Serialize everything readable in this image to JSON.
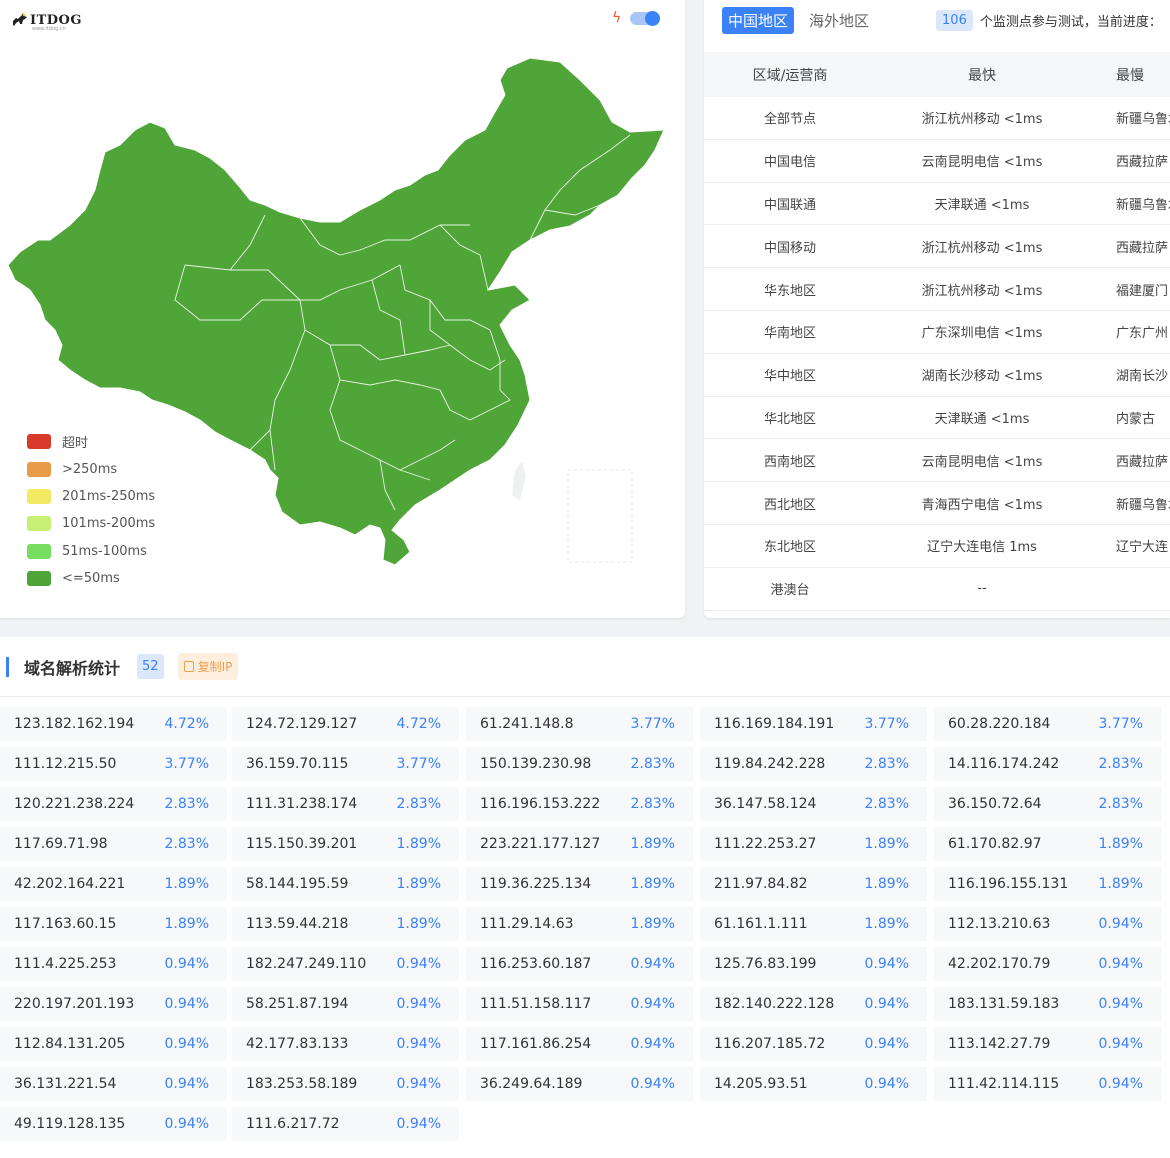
{
  "logo": {
    "text": "ITDOG",
    "sub": "www.itdog.cn"
  },
  "legend": [
    {
      "label": "超时",
      "color": "#d93a2b"
    },
    {
      "label": ">250ms",
      "color": "#e89c4a"
    },
    {
      "label": "201ms-250ms",
      "color": "#f2ea63"
    },
    {
      "label": "101ms-200ms",
      "color": "#c8ef76"
    },
    {
      "label": "51ms-100ms",
      "color": "#77dd5e"
    },
    {
      "label": "<=50ms",
      "color": "#4fa538"
    }
  ],
  "colors": {
    "map_fill": "#4fa538",
    "accent": "#3b82f6"
  },
  "region_panel": {
    "tab_active": "中国地区",
    "tab_other": "海外地区",
    "count": "106",
    "progress_text": "个监测点参与测试，当前进度：",
    "headers": [
      "区域/运营商",
      "最快",
      "最慢"
    ],
    "rows": [
      [
        "全部节点",
        "浙江杭州移动 <1ms",
        "新疆乌鲁木齐"
      ],
      [
        "中国电信",
        "云南昆明电信 <1ms",
        "西藏拉萨"
      ],
      [
        "中国联通",
        "天津联通 <1ms",
        "新疆乌鲁木齐"
      ],
      [
        "中国移动",
        "浙江杭州移动 <1ms",
        "西藏拉萨"
      ],
      [
        "华东地区",
        "浙江杭州移动 <1ms",
        "福建厦门"
      ],
      [
        "华南地区",
        "广东深圳电信 <1ms",
        "广东广州"
      ],
      [
        "华中地区",
        "湖南长沙移动 <1ms",
        "湖南长沙"
      ],
      [
        "华北地区",
        "天津联通 <1ms",
        "内蒙古"
      ],
      [
        "西南地区",
        "云南昆明电信 <1ms",
        "西藏拉萨"
      ],
      [
        "西北地区",
        "青海西宁电信 <1ms",
        "新疆乌鲁木齐"
      ],
      [
        "东北地区",
        "辽宁大连电信 1ms",
        "辽宁大连"
      ],
      [
        "港澳台",
        "--",
        ""
      ]
    ]
  },
  "dns": {
    "title": "域名解析统计",
    "count": "52",
    "copy_label": "复制IP",
    "items": [
      [
        "123.182.162.194",
        "4.72%"
      ],
      [
        "124.72.129.127",
        "4.72%"
      ],
      [
        "61.241.148.8",
        "3.77%"
      ],
      [
        "116.169.184.191",
        "3.77%"
      ],
      [
        "60.28.220.184",
        "3.77%"
      ],
      [
        "111.12.215.50",
        "3.77%"
      ],
      [
        "36.159.70.115",
        "3.77%"
      ],
      [
        "150.139.230.98",
        "2.83%"
      ],
      [
        "119.84.242.228",
        "2.83%"
      ],
      [
        "14.116.174.242",
        "2.83%"
      ],
      [
        "120.221.238.224",
        "2.83%"
      ],
      [
        "111.31.238.174",
        "2.83%"
      ],
      [
        "116.196.153.222",
        "2.83%"
      ],
      [
        "36.147.58.124",
        "2.83%"
      ],
      [
        "36.150.72.64",
        "2.83%"
      ],
      [
        "117.69.71.98",
        "2.83%"
      ],
      [
        "115.150.39.201",
        "1.89%"
      ],
      [
        "223.221.177.127",
        "1.89%"
      ],
      [
        "111.22.253.27",
        "1.89%"
      ],
      [
        "61.170.82.97",
        "1.89%"
      ],
      [
        "42.202.164.221",
        "1.89%"
      ],
      [
        "58.144.195.59",
        "1.89%"
      ],
      [
        "119.36.225.134",
        "1.89%"
      ],
      [
        "211.97.84.82",
        "1.89%"
      ],
      [
        "116.196.155.131",
        "1.89%"
      ],
      [
        "117.163.60.15",
        "1.89%"
      ],
      [
        "113.59.44.218",
        "1.89%"
      ],
      [
        "111.29.14.63",
        "1.89%"
      ],
      [
        "61.161.1.111",
        "1.89%"
      ],
      [
        "112.13.210.63",
        "0.94%"
      ],
      [
        "111.4.225.253",
        "0.94%"
      ],
      [
        "182.247.249.110",
        "0.94%"
      ],
      [
        "116.253.60.187",
        "0.94%"
      ],
      [
        "125.76.83.199",
        "0.94%"
      ],
      [
        "42.202.170.79",
        "0.94%"
      ],
      [
        "220.197.201.193",
        "0.94%"
      ],
      [
        "58.251.87.194",
        "0.94%"
      ],
      [
        "111.51.158.117",
        "0.94%"
      ],
      [
        "182.140.222.128",
        "0.94%"
      ],
      [
        "183.131.59.183",
        "0.94%"
      ],
      [
        "112.84.131.205",
        "0.94%"
      ],
      [
        "42.177.83.133",
        "0.94%"
      ],
      [
        "117.161.86.254",
        "0.94%"
      ],
      [
        "116.207.185.72",
        "0.94%"
      ],
      [
        "113.142.27.79",
        "0.94%"
      ],
      [
        "36.131.221.54",
        "0.94%"
      ],
      [
        "183.253.58.189",
        "0.94%"
      ],
      [
        "36.249.64.189",
        "0.94%"
      ],
      [
        "14.205.93.51",
        "0.94%"
      ],
      [
        "111.42.114.115",
        "0.94%"
      ],
      [
        "49.119.128.135",
        "0.94%"
      ],
      [
        "111.6.217.72",
        "0.94%"
      ]
    ]
  }
}
